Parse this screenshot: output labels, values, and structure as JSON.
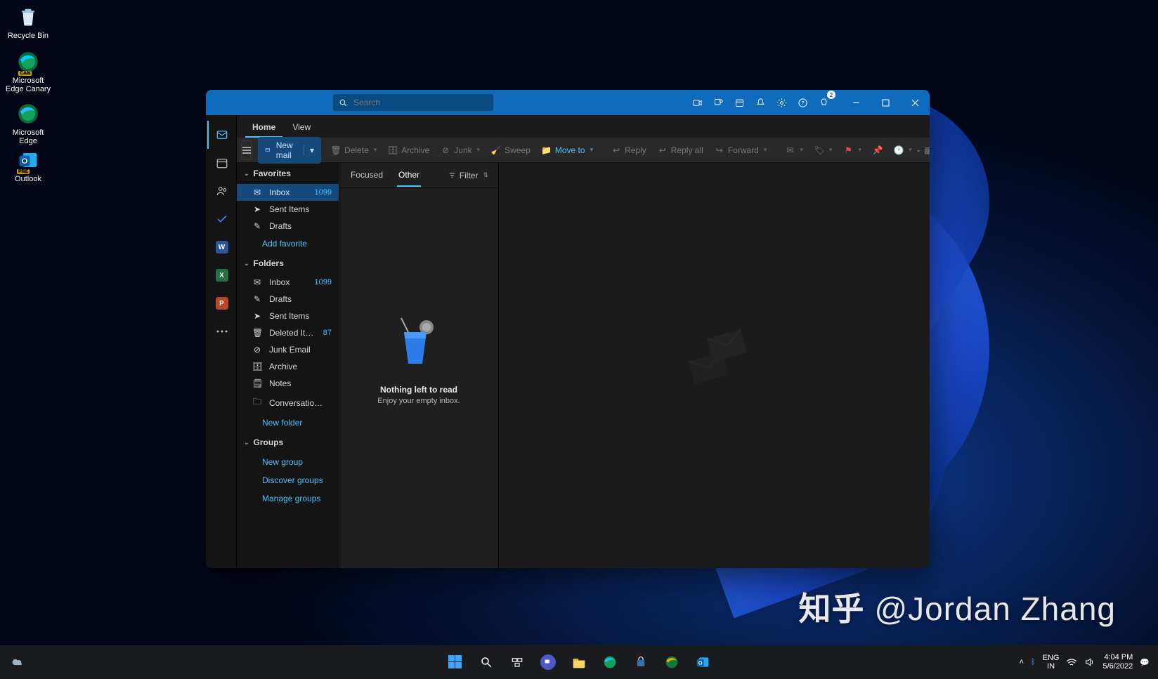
{
  "desktop_icons": [
    {
      "label": "Recycle Bin"
    },
    {
      "label": "Microsoft Edge Canary"
    },
    {
      "label": "Microsoft Edge"
    },
    {
      "label": "Outlook"
    }
  ],
  "search": {
    "placeholder": "Search"
  },
  "tips_badge": "2",
  "tabs": {
    "home": "Home",
    "view": "View"
  },
  "newmail": "New mail",
  "ribbon": {
    "delete": "Delete",
    "archive": "Archive",
    "junk": "Junk",
    "sweep": "Sweep",
    "moveto": "Move to",
    "reply": "Reply",
    "replyall": "Reply all",
    "forward": "Forward"
  },
  "sections": {
    "fav": "Favorites",
    "fold": "Folders",
    "grp": "Groups"
  },
  "fav": {
    "inbox": {
      "l": "Inbox",
      "c": "1099"
    },
    "sent": {
      "l": "Sent Items",
      "c": ""
    },
    "drafts": {
      "l": "Drafts",
      "c": ""
    },
    "add": "Add favorite"
  },
  "fold": {
    "inbox": {
      "l": "Inbox",
      "c": "1099"
    },
    "drafts": {
      "l": "Drafts",
      "c": ""
    },
    "sent": {
      "l": "Sent Items",
      "c": ""
    },
    "deleted": {
      "l": "Deleted Items",
      "c": "87"
    },
    "junk": {
      "l": "Junk Email",
      "c": ""
    },
    "archive": {
      "l": "Archive",
      "c": ""
    },
    "notes": {
      "l": "Notes",
      "c": ""
    },
    "conv": {
      "l": "Conversation His...",
      "c": ""
    },
    "new": "New folder"
  },
  "grp": {
    "new": "New group",
    "discover": "Discover groups",
    "manage": "Manage groups"
  },
  "msglist": {
    "focused": "Focused",
    "other": "Other",
    "filter": "Filter",
    "empty_title": "Nothing left to read",
    "empty_sub": "Enjoy your empty inbox."
  },
  "taskbar": {
    "lang1": "ENG",
    "lang2": "IN",
    "time": "4:04 PM",
    "date": "5/6/2022"
  },
  "watermark": {
    "zh": "知乎",
    "handle": "@Jordan Zhang"
  }
}
